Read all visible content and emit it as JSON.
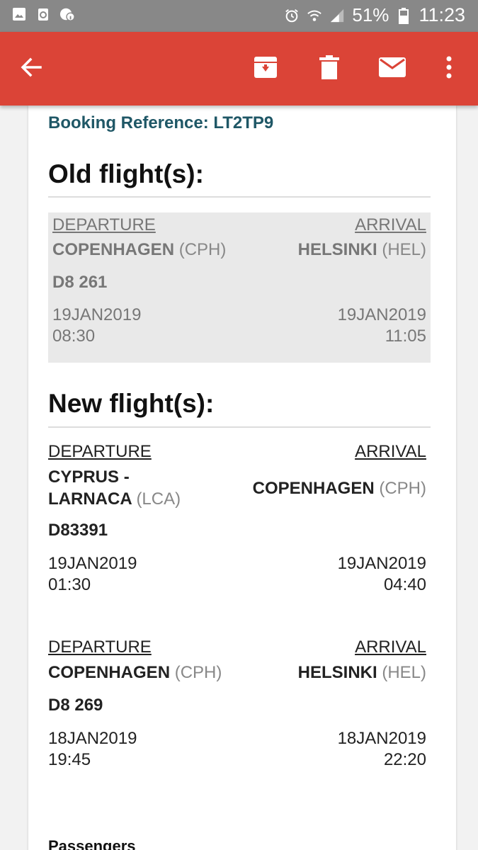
{
  "status_bar": {
    "battery": "51%",
    "time": "11:23",
    "icons": [
      "gallery-icon",
      "recycle-icon",
      "wifi-info-icon",
      "alarm-icon",
      "wifi-icon",
      "signal-icon",
      "battery-icon"
    ]
  },
  "toolbar": {
    "icons": [
      "back-arrow-icon",
      "archive-icon",
      "delete-icon",
      "mail-icon",
      "more-vert-icon"
    ],
    "color": "#db4437"
  },
  "email": {
    "booking_reference": "Booking Reference: LT2TP9",
    "old_section_title": "Old flight(s):",
    "new_section_title": "New flight(s):",
    "old_flights": [
      {
        "departure_label": "DEPARTURE",
        "arrival_label": "ARRIVAL",
        "from_city": "COPENHAGEN",
        "from_code": "(CPH)",
        "to_city": "HELSINKI",
        "to_code": "(HEL)",
        "flight_number": "D8 261",
        "dep_date": "19JAN2019",
        "dep_time": "08:30",
        "arr_date": "19JAN2019",
        "arr_time": "11:05"
      }
    ],
    "new_flights": [
      {
        "departure_label": "DEPARTURE",
        "arrival_label": "ARRIVAL",
        "from_city_line1": "CYPRUS -",
        "from_city_line2": "LARNACA",
        "from_code": "(LCA)",
        "to_city": "COPENHAGEN",
        "to_code": "(CPH)",
        "flight_number": "D83391",
        "dep_date": "19JAN2019",
        "dep_time": "01:30",
        "arr_date": "19JAN2019",
        "arr_time": "04:40"
      },
      {
        "departure_label": "DEPARTURE",
        "arrival_label": "ARRIVAL",
        "from_city": "COPENHAGEN",
        "from_code": "(CPH)",
        "to_city": "HELSINKI",
        "to_code": "(HEL)",
        "flight_number": "D8 269",
        "dep_date": "18JAN2019",
        "dep_time": "19:45",
        "arr_date": "18JAN2019",
        "arr_time": "22:20"
      }
    ],
    "passengers_heading": "Passengers"
  }
}
